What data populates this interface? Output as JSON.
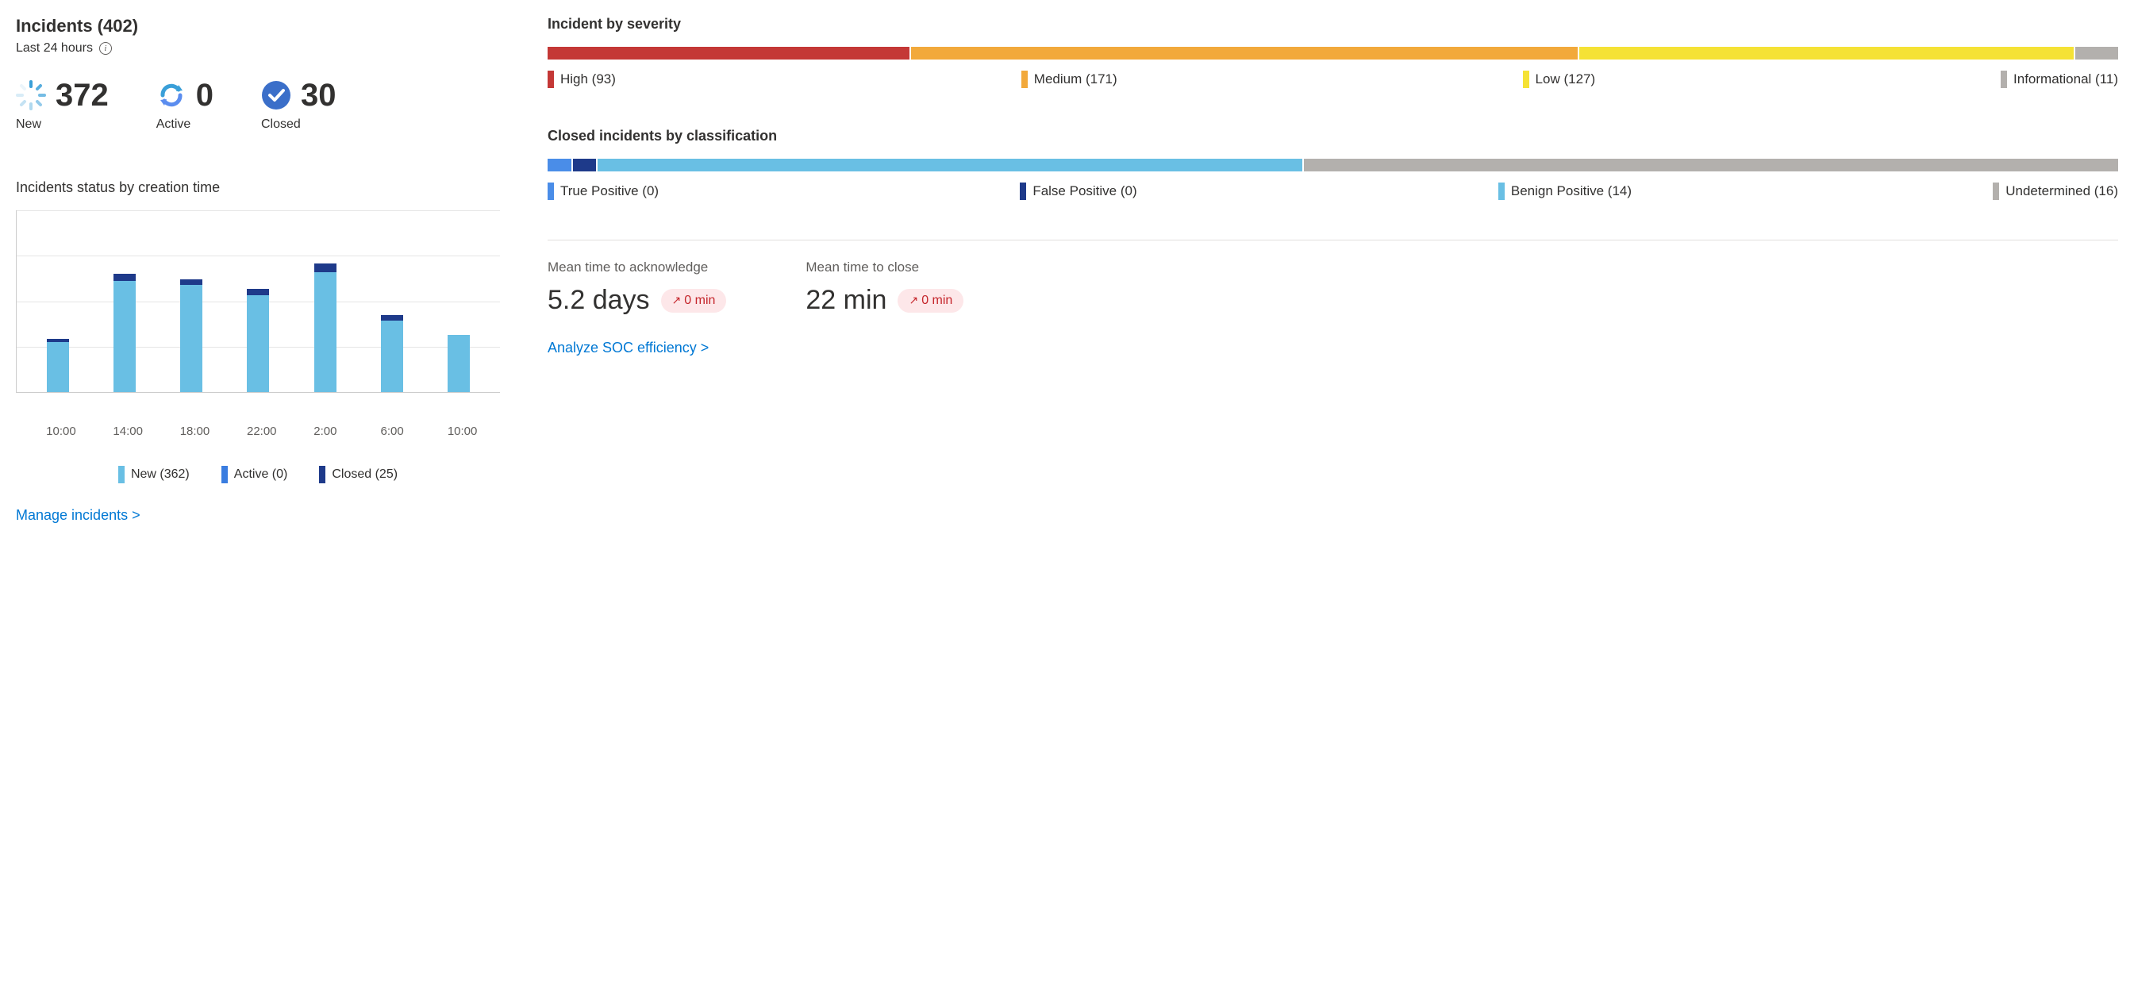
{
  "header": {
    "title": "Incidents (402)",
    "subtitle": "Last 24 hours"
  },
  "stats": {
    "new": {
      "value": "372",
      "label": "New"
    },
    "active": {
      "value": "0",
      "label": "Active"
    },
    "closed": {
      "value": "30",
      "label": "Closed"
    }
  },
  "status_chart": {
    "title": "Incidents status by creation time",
    "legend": {
      "new": "New (362)",
      "active": "Active (0)",
      "closed": "Closed (25)"
    }
  },
  "chart_data": {
    "type": "bar",
    "title": "Incidents status by creation time",
    "categories": [
      "10:00",
      "14:00",
      "18:00",
      "22:00",
      "2:00",
      "6:00",
      "10:00"
    ],
    "series": [
      {
        "name": "New",
        "values": [
          35,
          78,
          75,
          68,
          84,
          50,
          40
        ]
      },
      {
        "name": "Active",
        "values": [
          0,
          0,
          0,
          0,
          0,
          0,
          0
        ]
      },
      {
        "name": "Closed",
        "values": [
          2,
          5,
          4,
          4,
          6,
          4,
          0
        ]
      }
    ],
    "ymax": 100,
    "colors": {
      "New": "#69bfe4",
      "Active": "#3a7de0",
      "Closed": "#1e3a8a"
    }
  },
  "severity": {
    "title": "Incident by severity",
    "items": [
      {
        "label": "High (93)",
        "color": "#c43836",
        "value": 93
      },
      {
        "label": "Medium (171)",
        "color": "#f2a93b",
        "value": 171
      },
      {
        "label": "Low (127)",
        "color": "#f5e235",
        "value": 127
      },
      {
        "label": "Informational (11)",
        "color": "#b3b0ad",
        "value": 11
      }
    ],
    "total": 402
  },
  "classification": {
    "title": "Closed incidents by classification",
    "items": [
      {
        "label": "True Positive (0)",
        "color": "#4a8de8",
        "value": 0,
        "display_width": 1.5
      },
      {
        "label": "False Positive (0)",
        "color": "#1e3a8a",
        "value": 0,
        "display_width": 1.5
      },
      {
        "label": "Benign Positive (14)",
        "color": "#69bfe4",
        "value": 14,
        "display_width": 45
      },
      {
        "label": "Undetermined (16)",
        "color": "#b3b0ad",
        "value": 16,
        "display_width": 52
      }
    ]
  },
  "metrics": {
    "ack": {
      "label": "Mean time to acknowledge",
      "value": "5.2 days",
      "badge": "0 min"
    },
    "close": {
      "label": "Mean time to close",
      "value": "22 min",
      "badge": "0 min"
    }
  },
  "links": {
    "manage": "Manage incidents >",
    "analyze": "Analyze SOC efficiency >"
  }
}
